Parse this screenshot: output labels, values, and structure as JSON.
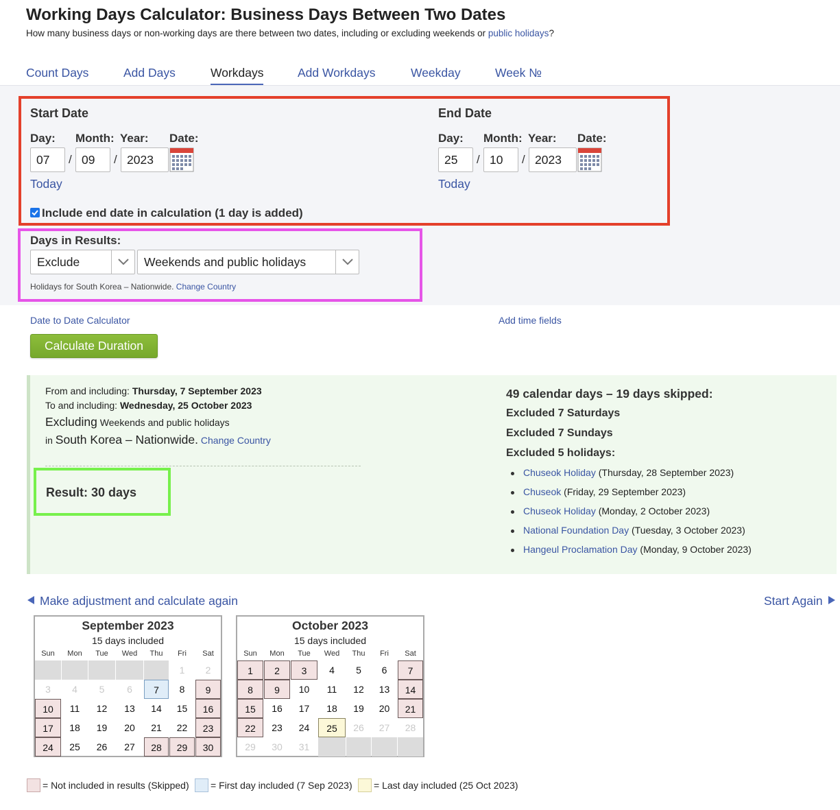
{
  "header": {
    "title": "Working Days Calculator: Business Days Between Two Dates",
    "subtitle_before": "How many business days or non-working days are there between two dates, including or excluding weekends or ",
    "subtitle_link": "public holidays",
    "subtitle_after": "?"
  },
  "tabs": [
    "Count Days",
    "Add Days",
    "Workdays",
    "Add Workdays",
    "Weekday",
    "Week №"
  ],
  "active_tab": "Workdays",
  "start": {
    "heading": "Start Date",
    "day_label": "Day:",
    "month_label": "Month:",
    "year_label": "Year:",
    "date_label": "Date:",
    "day": "07",
    "month": "09",
    "year": "2023",
    "today": "Today"
  },
  "end": {
    "heading": "End Date",
    "day_label": "Day:",
    "month_label": "Month:",
    "year_label": "Year:",
    "date_label": "Date:",
    "day": "25",
    "month": "10",
    "year": "2023",
    "today": "Today"
  },
  "separator": "/",
  "include_end": {
    "checked": true,
    "label": "Include end date in calculation (1 day is added)"
  },
  "days_in_results": {
    "label": "Days in Results:",
    "mode": "Exclude",
    "which": "Weekends and public holidays",
    "country_note": "Holidays for South Korea – Nationwide.",
    "change_country": "Change Country"
  },
  "links": {
    "date_to_date": "Date to Date Calculator",
    "add_time": "Add time fields"
  },
  "calculate_button": "Calculate Duration",
  "result": {
    "from_label": "From and including:",
    "from_value": "Thursday, 7 September 2023",
    "to_label": "To and including:",
    "to_value": "Wednesday, 25 October 2023",
    "excluding_word": "Excluding",
    "excluding_value": "Weekends and public holidays",
    "in_word": "in",
    "region": "South Korea – Nationwide.",
    "change_country": "Change Country",
    "result_text": "Result: 30 days"
  },
  "summary": {
    "headline": "49 calendar days – 19 days skipped:",
    "saturdays": "Excluded 7 Saturdays",
    "sundays": "Excluded 7 Sundays",
    "holidays_label": "Excluded 5 holidays:",
    "holidays": [
      {
        "name": "Chuseok Holiday",
        "date": "(Thursday, 28 September 2023)"
      },
      {
        "name": "Chuseok",
        "date": "(Friday, 29 September 2023)"
      },
      {
        "name": "Chuseok Holiday",
        "date": "(Monday, 2 October 2023)"
      },
      {
        "name": "National Foundation Day",
        "date": "(Tuesday, 3 October 2023)"
      },
      {
        "name": "Hangeul Proclamation Day",
        "date": "(Monday, 9 October 2023)"
      }
    ]
  },
  "nav": {
    "adjust": "Make adjustment and calculate again",
    "start_again": "Start Again"
  },
  "weekday_headers": [
    "Sun",
    "Mon",
    "Tue",
    "Wed",
    "Thu",
    "Fri",
    "Sat"
  ],
  "calendars": [
    {
      "title": "September 2023",
      "subtitle": "15 days included",
      "rows": [
        [
          {
            "d": "",
            "s": "empty"
          },
          {
            "d": "",
            "s": "empty"
          },
          {
            "d": "",
            "s": "empty"
          },
          {
            "d": "",
            "s": "empty"
          },
          {
            "d": "",
            "s": "empty"
          },
          {
            "d": "1",
            "s": "out"
          },
          {
            "d": "2",
            "s": "out"
          }
        ],
        [
          {
            "d": "3",
            "s": "out"
          },
          {
            "d": "4",
            "s": "out"
          },
          {
            "d": "5",
            "s": "out"
          },
          {
            "d": "6",
            "s": "out"
          },
          {
            "d": "7",
            "s": "first"
          },
          {
            "d": "8",
            "s": "in"
          },
          {
            "d": "9",
            "s": "skip"
          }
        ],
        [
          {
            "d": "10",
            "s": "skip"
          },
          {
            "d": "11",
            "s": "in"
          },
          {
            "d": "12",
            "s": "in"
          },
          {
            "d": "13",
            "s": "in"
          },
          {
            "d": "14",
            "s": "in"
          },
          {
            "d": "15",
            "s": "in"
          },
          {
            "d": "16",
            "s": "skip"
          }
        ],
        [
          {
            "d": "17",
            "s": "skip"
          },
          {
            "d": "18",
            "s": "in"
          },
          {
            "d": "19",
            "s": "in"
          },
          {
            "d": "20",
            "s": "in"
          },
          {
            "d": "21",
            "s": "in"
          },
          {
            "d": "22",
            "s": "in"
          },
          {
            "d": "23",
            "s": "skip"
          }
        ],
        [
          {
            "d": "24",
            "s": "skip"
          },
          {
            "d": "25",
            "s": "in"
          },
          {
            "d": "26",
            "s": "in"
          },
          {
            "d": "27",
            "s": "in"
          },
          {
            "d": "28",
            "s": "skip"
          },
          {
            "d": "29",
            "s": "skip"
          },
          {
            "d": "30",
            "s": "skip"
          }
        ]
      ]
    },
    {
      "title": "October 2023",
      "subtitle": "15 days included",
      "rows": [
        [
          {
            "d": "1",
            "s": "skip"
          },
          {
            "d": "2",
            "s": "skip"
          },
          {
            "d": "3",
            "s": "skip"
          },
          {
            "d": "4",
            "s": "in"
          },
          {
            "d": "5",
            "s": "in"
          },
          {
            "d": "6",
            "s": "in"
          },
          {
            "d": "7",
            "s": "skip"
          }
        ],
        [
          {
            "d": "8",
            "s": "skip"
          },
          {
            "d": "9",
            "s": "skip"
          },
          {
            "d": "10",
            "s": "in"
          },
          {
            "d": "11",
            "s": "in"
          },
          {
            "d": "12",
            "s": "in"
          },
          {
            "d": "13",
            "s": "in"
          },
          {
            "d": "14",
            "s": "skip"
          }
        ],
        [
          {
            "d": "15",
            "s": "skip"
          },
          {
            "d": "16",
            "s": "in"
          },
          {
            "d": "17",
            "s": "in"
          },
          {
            "d": "18",
            "s": "in"
          },
          {
            "d": "19",
            "s": "in"
          },
          {
            "d": "20",
            "s": "in"
          },
          {
            "d": "21",
            "s": "skip"
          }
        ],
        [
          {
            "d": "22",
            "s": "skip"
          },
          {
            "d": "23",
            "s": "in"
          },
          {
            "d": "24",
            "s": "in"
          },
          {
            "d": "25",
            "s": "last"
          },
          {
            "d": "26",
            "s": "out"
          },
          {
            "d": "27",
            "s": "out"
          },
          {
            "d": "28",
            "s": "out"
          }
        ],
        [
          {
            "d": "29",
            "s": "out"
          },
          {
            "d": "30",
            "s": "out"
          },
          {
            "d": "31",
            "s": "out"
          },
          {
            "d": "",
            "s": "empty"
          },
          {
            "d": "",
            "s": "empty"
          },
          {
            "d": "",
            "s": "empty"
          },
          {
            "d": "",
            "s": "empty"
          }
        ]
      ]
    }
  ],
  "legend": {
    "skipped": "= Not included in results (Skipped)",
    "first": "= First day included (7 Sep 2023)",
    "last": "= Last day included (25 Oct 2023)"
  },
  "colors": {
    "link": "#3a55a3",
    "button_green": "#7fb033",
    "skip_fill": "#f3e2e2",
    "first_fill": "#e0edf8",
    "last_fill": "#fcf8d8",
    "result_bg": "#f0f9ee",
    "highlight_red": "#e4402b",
    "highlight_magenta": "#e655e8",
    "highlight_green": "#77f04c"
  },
  "icons": {
    "calendar": "calendar-icon",
    "dropdown": "chevron-down-icon"
  }
}
